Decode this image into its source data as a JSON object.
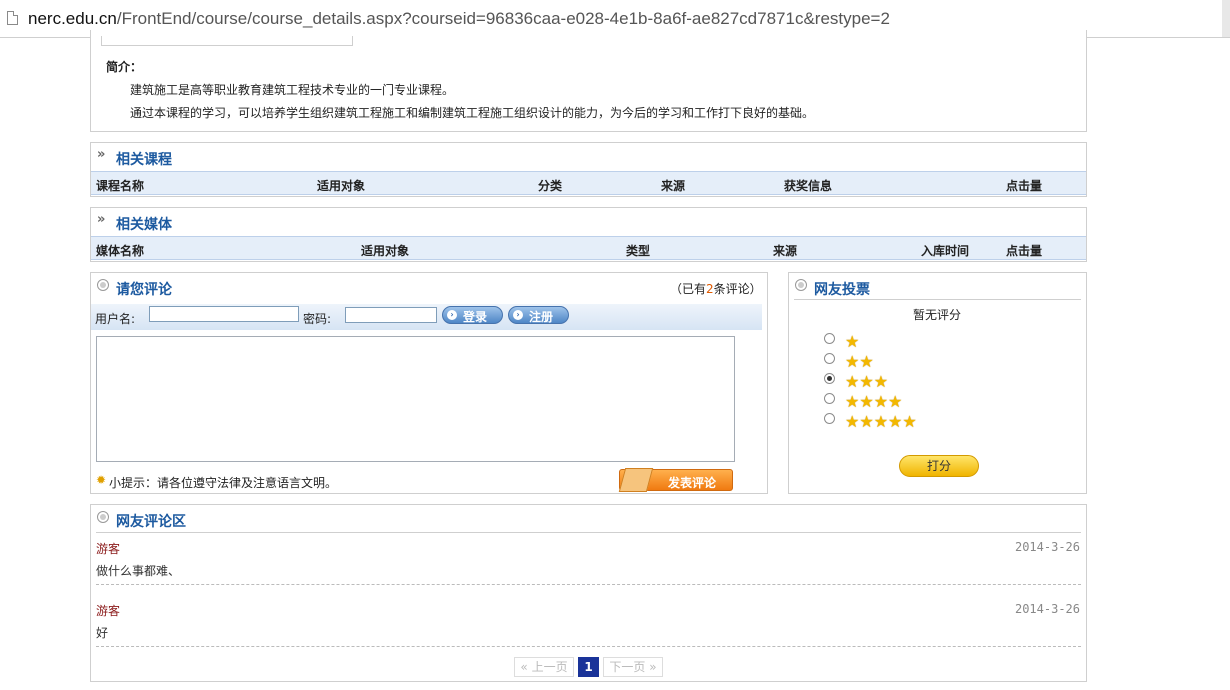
{
  "browser": {
    "url_host": "nerc.edu.cn",
    "url_path": "/FrontEnd/course/course_details.aspx?courseid=96836caa-e028-4e1b-8a6f-ae827cd7871c&restype=2"
  },
  "intro": {
    "label": "简介：",
    "lines": [
      "建筑施工是高等职业教育建筑工程技术专业的一门专业课程。",
      "通过本课程的学习，可以培养学生组织建筑工程施工和编制建筑工程施工组织设计的能力，为今后的学习和工作打下良好的基础。"
    ]
  },
  "related_courses": {
    "title": "相关课程",
    "columns": [
      "课程名称",
      "适用对象",
      "分类",
      "来源",
      "获奖信息",
      "点击量"
    ]
  },
  "related_media": {
    "title": "相关媒体",
    "columns": [
      "媒体名称",
      "适用对象",
      "类型",
      "来源",
      "入库时间",
      "点击量"
    ]
  },
  "comment_form": {
    "title": "请您评论",
    "count_prefix": "（已有",
    "count": "2",
    "count_suffix": "条评论）",
    "username_label": "用户名:",
    "password_label": "密码:",
    "login_label": "登录",
    "register_label": "注册",
    "tip": "小提示：请各位遵守法律及注意语言文明。",
    "submit_label": "发表评论"
  },
  "vote": {
    "title": "网友投票",
    "subtitle": "暂无评分",
    "options": [
      "★",
      "★★",
      "★★★",
      "★★★★",
      "★★★★★"
    ],
    "selected_index": 2,
    "rate_label": "打分"
  },
  "comments": {
    "title": "网友评论区",
    "items": [
      {
        "user": "游客",
        "date": "2014-3-26",
        "text": "做什么事都难、"
      },
      {
        "user": "游客",
        "date": "2014-3-26",
        "text": "好"
      }
    ],
    "pagination": {
      "prev": "« 上一页",
      "current": "1",
      "next": "下一页 »"
    }
  },
  "colors": {
    "title_blue": "#1d5aa0",
    "user_red": "#8b1a1a",
    "count_orange": "#e05a00",
    "page_current": "#1a3399"
  }
}
